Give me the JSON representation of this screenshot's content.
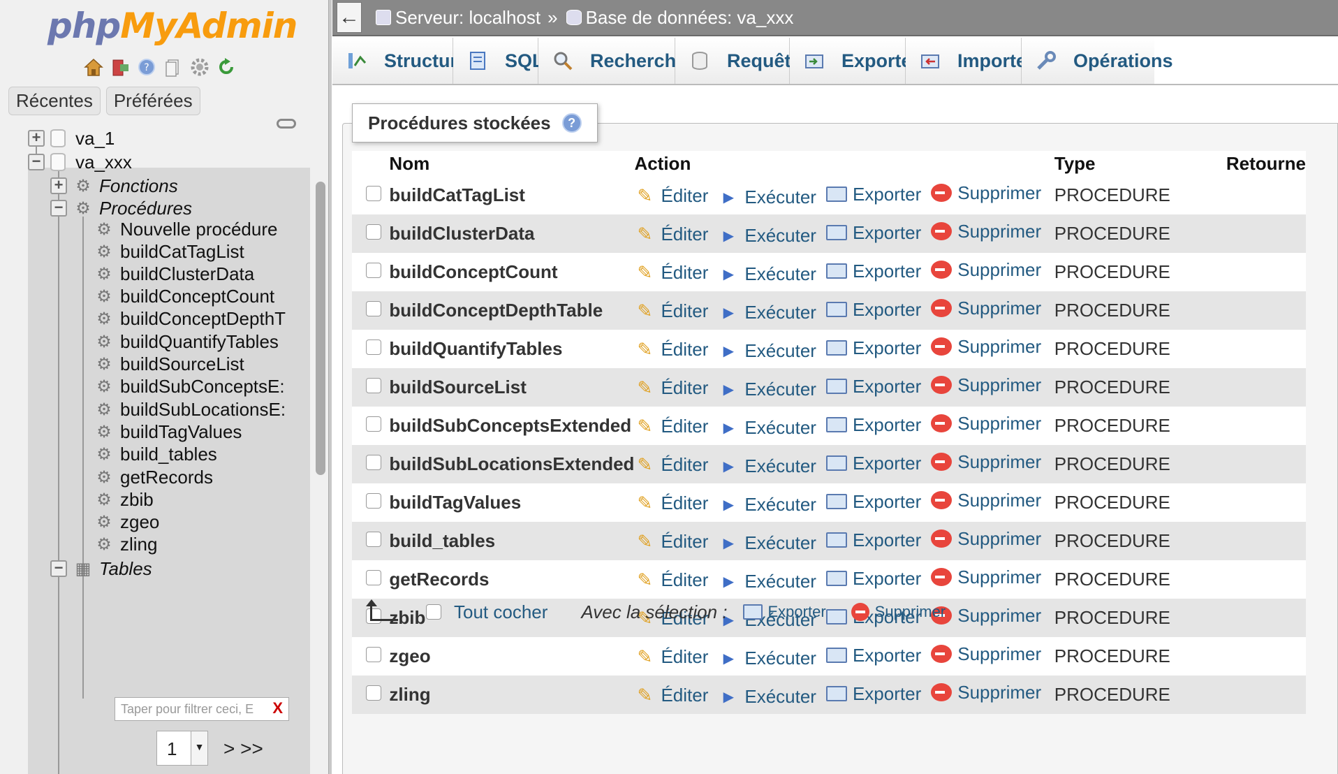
{
  "logo": {
    "part1": "php",
    "part2": "MyAdmin"
  },
  "nav_icons": [
    "home-icon",
    "exit-icon",
    "help-icon",
    "documentation-icon",
    "settings-icon",
    "reload-icon"
  ],
  "nav_tabs": [
    "Récentes",
    "Préférées"
  ],
  "tree": {
    "dbs": [
      "va_1",
      "va_xxx"
    ],
    "groups": {
      "functions": "Fonctions",
      "procedures": "Procédures",
      "tables": "Tables"
    },
    "new_procedure": "Nouvelle procédure",
    "procedures": [
      "buildCatTagList",
      "buildClusterData",
      "buildConceptCount",
      "buildConceptDepthT",
      "buildQuantifyTables",
      "buildSourceList",
      "buildSubConceptsE:",
      "buildSubLocationsE:",
      "buildTagValues",
      "build_tables",
      "getRecords",
      "zbib",
      "zgeo",
      "zling"
    ],
    "filter_placeholder": "Taper pour filtrer ceci, E",
    "filter_clear": "X",
    "page_value": "1",
    "page_next": "> >>"
  },
  "breadcrumb": {
    "server": "Serveur: localhost",
    "separator": "»",
    "database": "Base de données: va_xxx"
  },
  "menu_tabs": [
    {
      "label": "Structure",
      "icon": "structure-icon"
    },
    {
      "label": "SQL",
      "icon": "sql-icon"
    },
    {
      "label": "Rechercher",
      "icon": "search-icon"
    },
    {
      "label": "Requête",
      "icon": "query-icon"
    },
    {
      "label": "Exporter",
      "icon": "export-icon"
    },
    {
      "label": "Importer",
      "icon": "import-icon"
    },
    {
      "label": "Opérations",
      "icon": "operations-icon"
    }
  ],
  "panel": {
    "title": "Procédures stockées",
    "headers": {
      "name": "Nom",
      "action": "Action",
      "type": "Type",
      "returns": "Retourne"
    },
    "actions": {
      "edit": "Éditer",
      "execute": "Exécuter",
      "export": "Exporter",
      "delete": "Supprimer"
    },
    "rows": [
      {
        "name": "buildCatTagList",
        "type": "PROCEDURE"
      },
      {
        "name": "buildClusterData",
        "type": "PROCEDURE"
      },
      {
        "name": "buildConceptCount",
        "type": "PROCEDURE"
      },
      {
        "name": "buildConceptDepthTable",
        "type": "PROCEDURE"
      },
      {
        "name": "buildQuantifyTables",
        "type": "PROCEDURE"
      },
      {
        "name": "buildSourceList",
        "type": "PROCEDURE"
      },
      {
        "name": "buildSubConceptsExtended",
        "type": "PROCEDURE"
      },
      {
        "name": "buildSubLocationsExtended",
        "type": "PROCEDURE"
      },
      {
        "name": "buildTagValues",
        "type": "PROCEDURE"
      },
      {
        "name": "build_tables",
        "type": "PROCEDURE"
      },
      {
        "name": "getRecords",
        "type": "PROCEDURE"
      },
      {
        "name": "zbib",
        "type": "PROCEDURE"
      },
      {
        "name": "zgeo",
        "type": "PROCEDURE"
      },
      {
        "name": "zling",
        "type": "PROCEDURE"
      }
    ],
    "footer": {
      "check_all": "Tout cocher",
      "with_selection": "Avec la sélection :",
      "export": "Exporter",
      "delete": "Supprimer"
    }
  },
  "colors": {
    "link": "#235a81",
    "logo_php": "#6c78af",
    "logo_myadmin": "#f89c0e",
    "topbar": "#888888",
    "delete": "#e8453c"
  }
}
